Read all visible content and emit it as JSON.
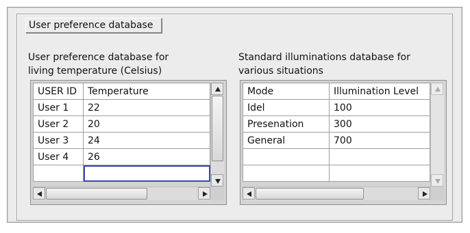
{
  "group": {
    "label": "User preference database"
  },
  "temperature_table": {
    "caption_line1": "User preference database for",
    "caption_line2": "living temperature  (Celsius)",
    "columns": [
      "USER ID",
      "Temperature"
    ],
    "rows": [
      [
        "User 1",
        "22"
      ],
      [
        "User 2",
        "20"
      ],
      [
        "User 3",
        "24"
      ],
      [
        "User 4",
        "26"
      ]
    ]
  },
  "illumination_table": {
    "caption_line1": "Standard illuminations database for",
    "caption_line2": "various situations",
    "columns": [
      "Mode",
      "Illumination Level"
    ],
    "rows": [
      [
        "Idel",
        "100"
      ],
      [
        "Presenation",
        "300"
      ],
      [
        "General",
        "700"
      ]
    ]
  },
  "colors": {
    "panel_bg": "#ececec",
    "active_cell_border": "#3c4aa8"
  },
  "icons": [
    "scroll-up-arrow-icon",
    "scroll-down-arrow-icon",
    "scroll-left-arrow-icon",
    "scroll-right-arrow-icon"
  ]
}
